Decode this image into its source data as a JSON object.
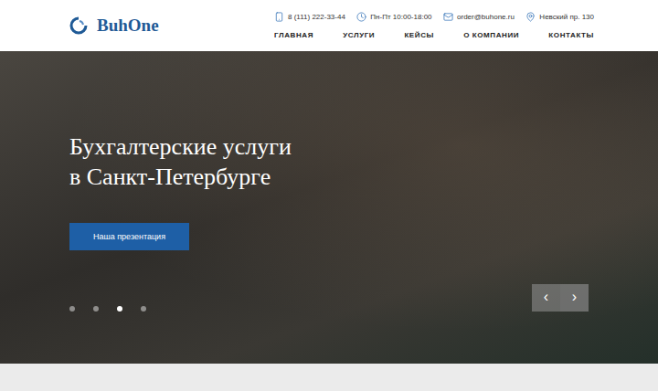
{
  "logo": {
    "text": "BuhOne"
  },
  "contacts": [
    {
      "kind": "phone",
      "text": "8 (111) 222-33-44"
    },
    {
      "kind": "hours",
      "text": "Пн-Пт 10:00-18:00"
    },
    {
      "kind": "mail",
      "text": "order@buhone.ru"
    },
    {
      "kind": "address",
      "text": "Невский пр. 130"
    }
  ],
  "nav": [
    "ГЛАВНАЯ",
    "УСЛУГИ",
    "КЕЙСЫ",
    "О КОМПАНИИ",
    "КОНТАКТЫ"
  ],
  "hero": {
    "title": [
      "Бухгалтерские услуги",
      "в Санкт-Петербурге"
    ],
    "button": "Наша презентация",
    "slides": [
      {
        "selected": false
      },
      {
        "selected": false
      },
      {
        "selected": true
      },
      {
        "selected": false
      }
    ],
    "arrows": [
      "‹",
      "›"
    ]
  }
}
